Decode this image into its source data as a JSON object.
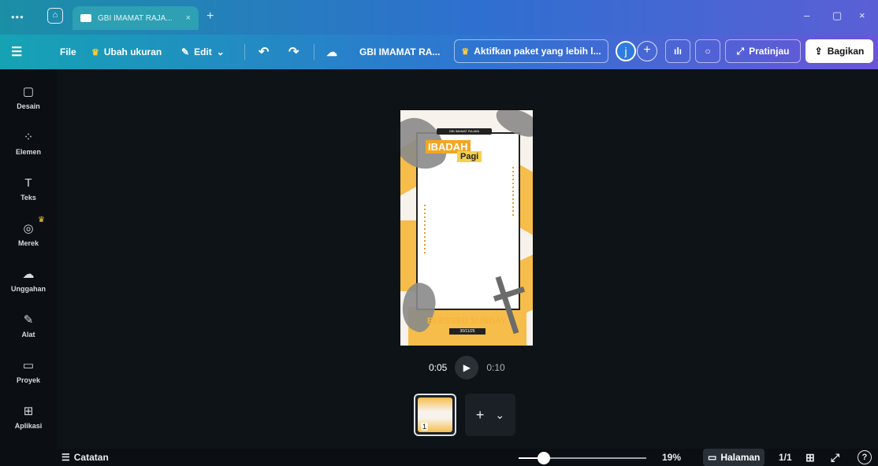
{
  "browser": {
    "menu_dots": "•••",
    "home_icon": "home-icon",
    "tab_title": "GBI IMAMAT RAJA...",
    "tab_close": "×",
    "new_tab": "+",
    "window_minimize": "–",
    "window_restore": "▢",
    "window_close": "×"
  },
  "toolbar": {
    "menu_icon": "☰",
    "file": "File",
    "resize": "Ubah ukuran",
    "edit": "Edit",
    "edit_chevron": "⌄",
    "undo": "↶",
    "redo": "↷",
    "cloud": "☁",
    "doc_title": "GBI IMAMAT RA...",
    "upgrade": "Aktifkan paket yang lebih l...",
    "avatar_initial": "j",
    "add_user": "+",
    "stats": "ılı",
    "comment": "○",
    "preview": "Pratinjau",
    "share": "Bagikan"
  },
  "sidebar": {
    "items": [
      {
        "label": "Desain",
        "icon": "▢"
      },
      {
        "label": "Elemen",
        "icon": "⁘"
      },
      {
        "label": "Teks",
        "icon": "T"
      },
      {
        "label": "Merek",
        "icon": "◎"
      },
      {
        "label": "Unggahan",
        "icon": "☁"
      },
      {
        "label": "Alat",
        "icon": "✎"
      },
      {
        "label": "Proyek",
        "icon": "▭"
      },
      {
        "label": "Aplikasi",
        "icon": "⊞"
      }
    ]
  },
  "design": {
    "logo_text": "GBI IMAMAT RAJANI",
    "ibadah": "IBADAH",
    "pagi": "Pagi",
    "blessed": "BLESSED SUNDAY",
    "date": "30/11/25"
  },
  "player": {
    "current_time": "0:05",
    "total_time": "0:10"
  },
  "pages": {
    "thumb_number": "1",
    "add": "+",
    "more": "⌄"
  },
  "bottom": {
    "notes": "Catatan",
    "zoom": "19%",
    "zoom_fraction": 0.19,
    "pages_label": "Halaman",
    "page_count": "1/1",
    "help": "?"
  },
  "colors": {
    "accent_teal": "#15a3b4",
    "accent_purple": "#6a55d8",
    "crown": "#ffcc33",
    "design_yellow": "#f6bd4b"
  }
}
